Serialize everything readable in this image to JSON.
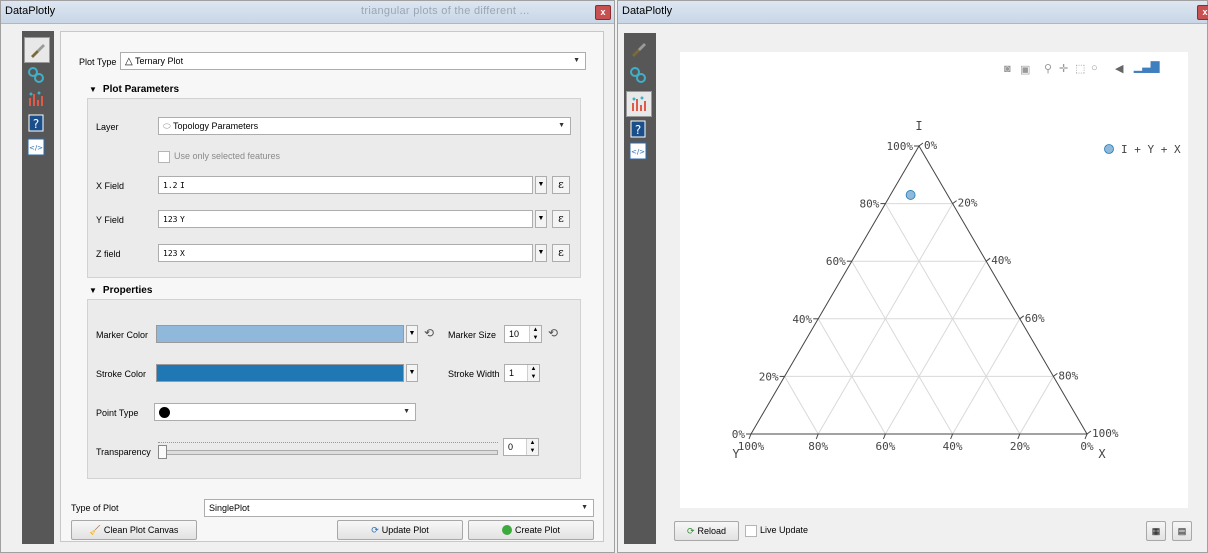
{
  "left_window": {
    "title": "DataPlotly",
    "background_title": "triangular plots of the different ...",
    "close_label": "x",
    "plot_type_label": "Plot Type",
    "plot_type_value": "Ternary Plot",
    "plot_parameters": {
      "header": "Plot Parameters",
      "layer_label": "Layer",
      "layer_value": "Topology Parameters",
      "selected_features_label": "Use only selected features",
      "x_label": "X Field",
      "x_type": "1.2",
      "x_value": "I",
      "y_label": "Y Field",
      "y_type": "123",
      "y_value": "Y",
      "z_label": "Z field",
      "z_type": "123",
      "z_value": "X",
      "expr_symbol": "ε"
    },
    "properties": {
      "header": "Properties",
      "marker_color_label": "Marker Color",
      "marker_color": "#8fb8da",
      "marker_size_label": "Marker Size",
      "marker_size": "10",
      "stroke_color_label": "Stroke Color",
      "stroke_color": "#1f78b4",
      "stroke_width_label": "Stroke Width",
      "stroke_width": "1",
      "point_type_label": "Point Type",
      "transparency_label": "Transparency",
      "transparency_value": "0",
      "transparency_level": 0
    },
    "type_of_plot_label": "Type of Plot",
    "type_of_plot_value": "SinglePlot",
    "clean_button": "Clean Plot Canvas",
    "update_button": "Update Plot",
    "create_button": "Create Plot"
  },
  "right_window": {
    "title": "DataPlotly",
    "close_label": "x",
    "reload_button": "Reload",
    "live_update_label": "Live Update",
    "modebar_icons": [
      "camera-icon",
      "save-icon",
      "zoom-icon",
      "pan-icon",
      "box-select-icon",
      "lasso-icon",
      "toggle-spike-icon",
      "plotly-logo-icon"
    ]
  },
  "chart_data": {
    "type": "scatter",
    "subtype": "ternary",
    "axes": {
      "a": {
        "title": "I",
        "ticks": [
          "0%",
          "20%",
          "40%",
          "60%",
          "80%",
          "100%"
        ]
      },
      "b": {
        "title": "Y",
        "ticks": [
          "0%",
          "20%",
          "40%",
          "60%",
          "80%",
          "100%"
        ]
      },
      "c": {
        "title": "X",
        "ticks": [
          "0%",
          "20%",
          "40%",
          "60%",
          "80%",
          "100%"
        ]
      }
    },
    "series": [
      {
        "name": "I + Y + X",
        "points": [
          {
            "a": 0.83,
            "b": 0.11,
            "c": 0.06
          }
        ],
        "color": "#8fb8da",
        "stroke": "#1f78b4"
      }
    ],
    "grid": true,
    "legend_placement": "top-right"
  }
}
